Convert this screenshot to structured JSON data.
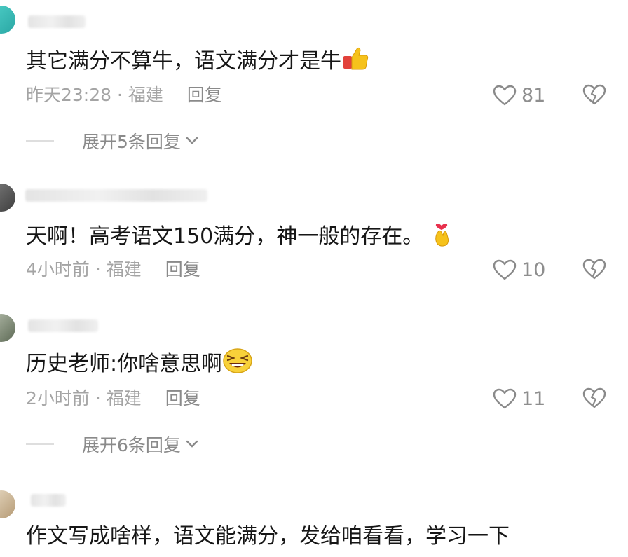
{
  "comments": [
    {
      "text": "其它满分不算牛，语文满分才是牛",
      "emoji": "thumbs-up-icon",
      "time": "昨天23:28",
      "location": "福建",
      "reply_label": "回复",
      "likes": "81",
      "expand_label": "展开5条回复"
    },
    {
      "text": "天啊！高考语文150满分，神一般的存在。",
      "emoji": "finger-heart-icon",
      "time": "4小时前",
      "location": "福建",
      "reply_label": "回复",
      "likes": "10"
    },
    {
      "text": "历史老师:你啥意思啊",
      "emoji": "laughing-face-icon",
      "time": "2小时前",
      "location": "福建",
      "reply_label": "回复",
      "likes": "11",
      "expand_label": "展开6条回复"
    },
    {
      "text": "作文写成啥样，语文能满分，发给咱看看，学习一下"
    }
  ],
  "separator": " · ",
  "colors": {
    "meta": "#a4a4a4",
    "text": "#161616",
    "icon": "#8e8e8e"
  }
}
